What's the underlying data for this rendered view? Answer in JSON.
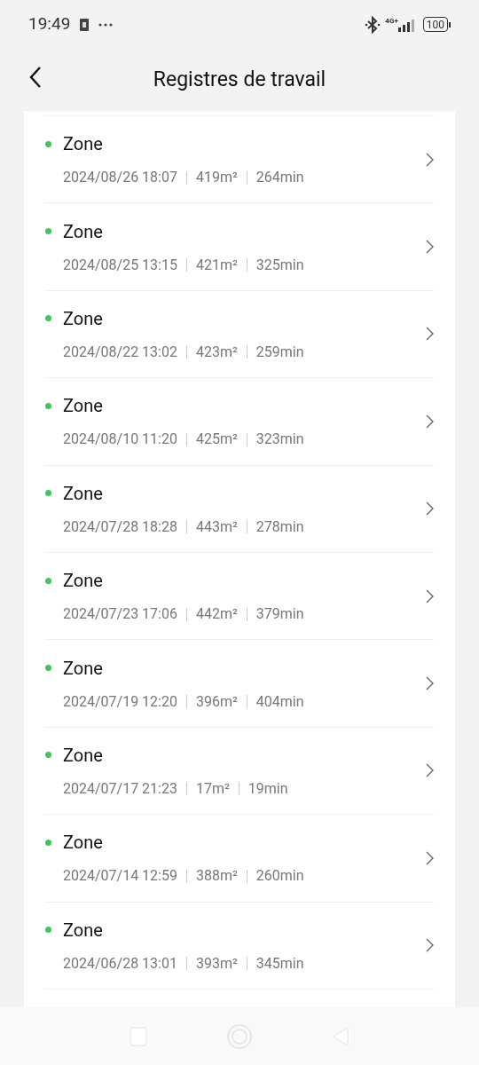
{
  "status_bar": {
    "time": "19:49",
    "network": "4G+",
    "battery": "100"
  },
  "header": {
    "title": "Registres de travail"
  },
  "records": [
    {
      "name": "Zone",
      "color": "#3cc85a",
      "date": "2024/08/26 18:07",
      "area": "419m²",
      "duration": "264min"
    },
    {
      "name": "Zone",
      "color": "#3cc85a",
      "date": "2024/08/25 13:15",
      "area": "421m²",
      "duration": "325min"
    },
    {
      "name": "Zone",
      "color": "#3cc85a",
      "date": "2024/08/22 13:02",
      "area": "423m²",
      "duration": "259min"
    },
    {
      "name": "Zone",
      "color": "#3cc85a",
      "date": "2024/08/10 11:20",
      "area": "425m²",
      "duration": "323min"
    },
    {
      "name": "Zone",
      "color": "#3cc85a",
      "date": "2024/07/28 18:28",
      "area": "443m²",
      "duration": "278min"
    },
    {
      "name": "Zone",
      "color": "#3cc85a",
      "date": "2024/07/23 17:06",
      "area": "442m²",
      "duration": "379min"
    },
    {
      "name": "Zone",
      "color": "#3cc85a",
      "date": "2024/07/19 12:20",
      "area": "396m²",
      "duration": "404min"
    },
    {
      "name": "Zone",
      "color": "#3cc85a",
      "date": "2024/07/17 21:23",
      "area": "17m²",
      "duration": "19min"
    },
    {
      "name": "Zone",
      "color": "#3cc85a",
      "date": "2024/07/14 12:59",
      "area": "388m²",
      "duration": "260min"
    },
    {
      "name": "Zone",
      "color": "#3cc85a",
      "date": "2024/06/28 13:01",
      "area": "393m²",
      "duration": "345min"
    }
  ]
}
